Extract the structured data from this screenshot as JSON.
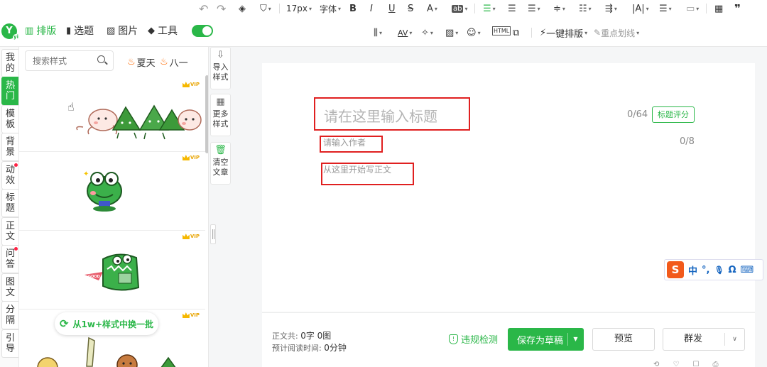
{
  "logo": {
    "letter": "Y",
    "sub": "yi"
  },
  "nav": [
    {
      "label": "排版",
      "icon": "▥"
    },
    {
      "label": "选题",
      "icon": "▮"
    },
    {
      "label": "图片",
      "icon": "▨"
    },
    {
      "label": "工具",
      "icon": "◆"
    }
  ],
  "toolbar": {
    "undo": "↶",
    "redo": "↷",
    "font_size": "17px",
    "font_family": "字体",
    "bold": "B",
    "italic": "I",
    "underline": "U",
    "strike": "S",
    "font_color": "A",
    "bg_color": "ab",
    "one_click_layout": "一键排版",
    "key_underline": "重点划线",
    "letter_spacing": "AV",
    "quote": "❞"
  },
  "side_tabs": [
    {
      "label": "我的",
      "active": false,
      "dot": false
    },
    {
      "label": "热门",
      "active": true,
      "dot": false
    },
    {
      "label": "模板",
      "active": false,
      "dot": false
    },
    {
      "label": "背景",
      "active": false,
      "dot": false
    },
    {
      "label": "动效",
      "active": false,
      "dot": true
    },
    {
      "label": "标题",
      "active": false,
      "dot": false
    },
    {
      "label": "正文",
      "active": false,
      "dot": false
    },
    {
      "label": "问答",
      "active": false,
      "dot": true
    },
    {
      "label": "图文",
      "active": false,
      "dot": false
    },
    {
      "label": "分隔",
      "active": false,
      "dot": false
    },
    {
      "label": "引导",
      "active": false,
      "dot": false
    }
  ],
  "panel": {
    "search_placeholder": "搜索样式",
    "hot_tags": [
      "夏天",
      "八一"
    ],
    "vip_label": "VIP",
    "swap_label": "从1w+样式中换一批"
  },
  "side_actions": [
    {
      "label": "导入样式",
      "icon": "⇩"
    },
    {
      "label": "更多样式",
      "icon": "▦"
    },
    {
      "label": "清空文章",
      "icon": "🗑"
    }
  ],
  "editor": {
    "title_placeholder": "请在这里输入标题",
    "title_count": "0/64",
    "title_score": "标题评分",
    "author_placeholder": "请输入作者",
    "author_count": "0/8",
    "body_placeholder": "从这里开始写正文"
  },
  "ime": {
    "logo": "S",
    "mode": "中",
    "punct": "°,",
    "mic": "🎙",
    "omega": "Ω",
    "kb": "⌨"
  },
  "footer": {
    "total_label": "正文共:",
    "total_value": "0字 0图",
    "read_label": "预计阅读时间:",
    "read_value": "0分钟",
    "check_label": "违规检测",
    "save_label": "保存为草稿",
    "preview_label": "预览",
    "publish_label": "群发"
  },
  "colors": {
    "accent": "#2ab748",
    "annotation": "#e02020"
  }
}
